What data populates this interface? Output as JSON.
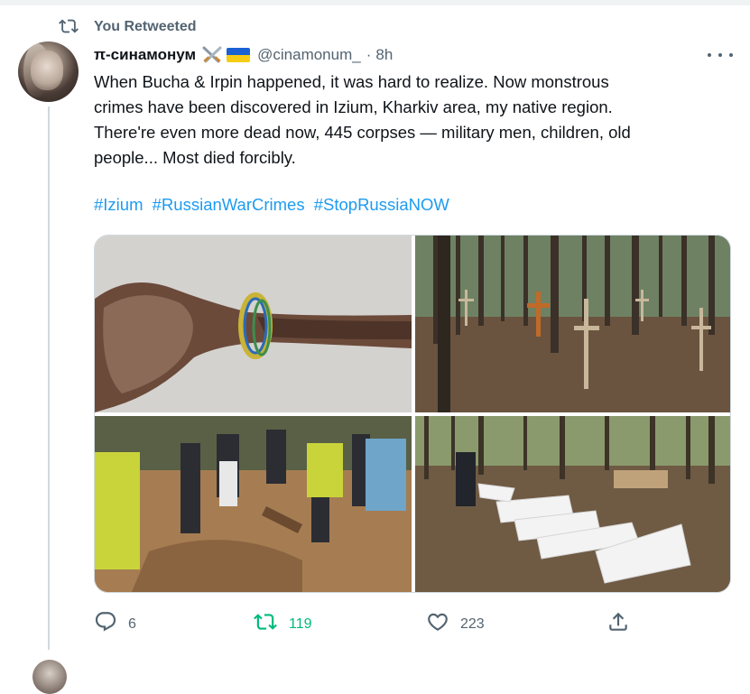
{
  "retweet": {
    "label": "You Retweeted"
  },
  "tweet": {
    "display_name": "π-синамонум",
    "handle": "@cinamonum_",
    "separator": "·",
    "time": "8h",
    "text_lines": [
      "When Bucha & Irpin happened, it was hard to realize. Now monstrous",
      "crimes have been discovered in Izium, Kharkiv area, my native region.",
      "There're even more dead now, 445 corpses — military men, children, old",
      "people... Most died forcibly."
    ],
    "hashtags": [
      "#Izium",
      "#RussianWarCrimes",
      "#StopRussiaNOW"
    ],
    "photos": [
      {
        "name": "photo-remains-with-bracelet"
      },
      {
        "name": "photo-forest-graves-crosses"
      },
      {
        "name": "photo-investigators-exhumation"
      },
      {
        "name": "photo-body-bags-forest"
      }
    ]
  },
  "actions": {
    "reply_count": "6",
    "retweet_count": "119",
    "like_count": "223"
  },
  "icons": {
    "retweet": "retweet-icon",
    "reply": "reply-icon",
    "like": "heart-icon",
    "share": "share-icon",
    "more": "more-icon",
    "swords": "crossed-swords-emoji",
    "flag": "ukraine-flag-emoji"
  },
  "colors": {
    "accent": "#1d9bf0",
    "retweet_active": "#00ba7c",
    "secondary_text": "#536471",
    "ukraine_blue": "#1a62d4",
    "ukraine_yellow": "#f6cd14"
  }
}
